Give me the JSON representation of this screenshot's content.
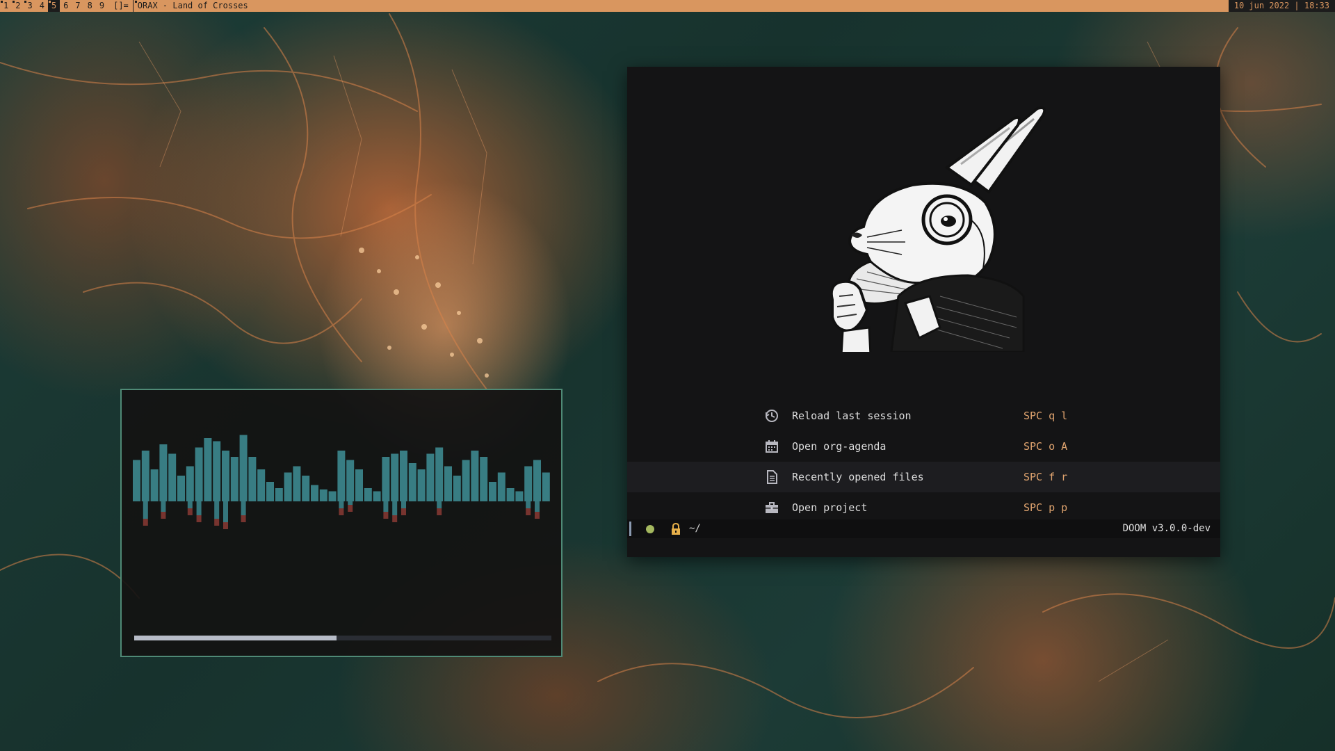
{
  "topbar": {
    "workspaces": [
      {
        "label": "1",
        "occupied": true,
        "active": false
      },
      {
        "label": "2",
        "occupied": true,
        "active": false
      },
      {
        "label": "3",
        "occupied": true,
        "active": false
      },
      {
        "label": "4",
        "occupied": false,
        "active": false
      },
      {
        "label": "5",
        "occupied": true,
        "active": true
      },
      {
        "label": "6",
        "occupied": false,
        "active": false
      },
      {
        "label": "7",
        "occupied": false,
        "active": false
      },
      {
        "label": "8",
        "occupied": false,
        "active": false
      },
      {
        "label": "9",
        "occupied": false,
        "active": false
      }
    ],
    "layout_symbol": "[]=",
    "window_title": "ORAX - Land of Crosses",
    "status": "10 jun 2022 | 18:33",
    "colors": {
      "bar": "#d9965f",
      "dark": "#1c1c1c"
    }
  },
  "visualizer": {
    "progress": 0.485,
    "colors": {
      "bars": "#3f8f96",
      "peaks": "#8a3a34",
      "progress": "#b7bcc8",
      "border": "#4f8a76"
    }
  },
  "doom": {
    "menu": [
      {
        "icon": "history-icon",
        "label": "Reload last session",
        "key": "SPC q l"
      },
      {
        "icon": "calendar-icon",
        "label": "Open org-agenda",
        "key": "SPC o A"
      },
      {
        "icon": "file-icon",
        "label": "Recently opened files",
        "key": "SPC f r"
      },
      {
        "icon": "briefcase-icon",
        "label": "Open project",
        "key": "SPC p p"
      }
    ],
    "modeline": {
      "directory": "~/",
      "version": "DOOM v3.0.0-dev"
    },
    "colors": {
      "background": "#141415",
      "accent": "#e0a46f",
      "status_dot": "#a4b85f",
      "lock": "#e7b04a"
    }
  }
}
